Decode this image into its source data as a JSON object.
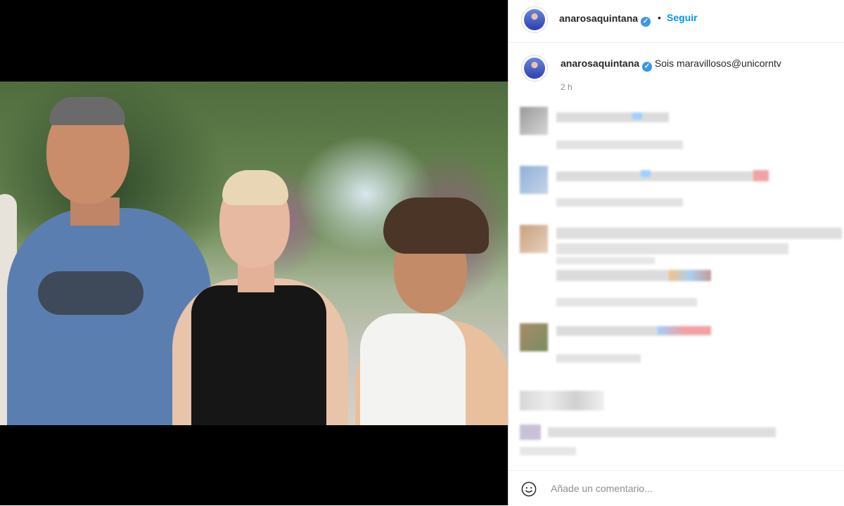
{
  "post": {
    "username": "anarosaquintana",
    "verified_icon": "verified-badge-icon",
    "separator": "•",
    "follow_label": "Seguir",
    "caption": "Sois maravillosos@unicorntv",
    "time": "2 h"
  },
  "comment_box": {
    "placeholder": "Añade un comentario...",
    "emoji_icon": "smiley-icon"
  },
  "colors": {
    "accent": "#0095f6",
    "verified": "#3897f0",
    "text": "#262626",
    "secondary": "#8e8e8e"
  }
}
